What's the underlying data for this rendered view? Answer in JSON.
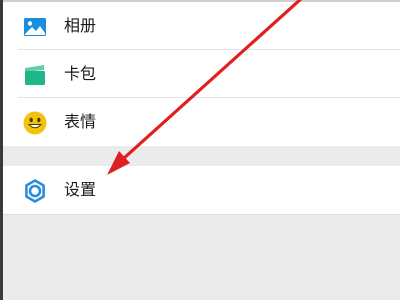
{
  "menu": {
    "items": [
      {
        "label": "相册",
        "icon": "photo-album-icon",
        "color": "#1a8ddb"
      },
      {
        "label": "卡包",
        "icon": "card-wallet-icon",
        "color": "#1fb78a"
      },
      {
        "label": "表情",
        "icon": "emoji-smiley-icon",
        "color": "#f4c20d"
      }
    ],
    "settings": {
      "label": "设置",
      "icon": "gear-icon",
      "color": "#2a8ddb"
    }
  },
  "colors": {
    "annotation_arrow": "#e02020",
    "background": "#ebebeb",
    "item_background": "#ffffff"
  }
}
